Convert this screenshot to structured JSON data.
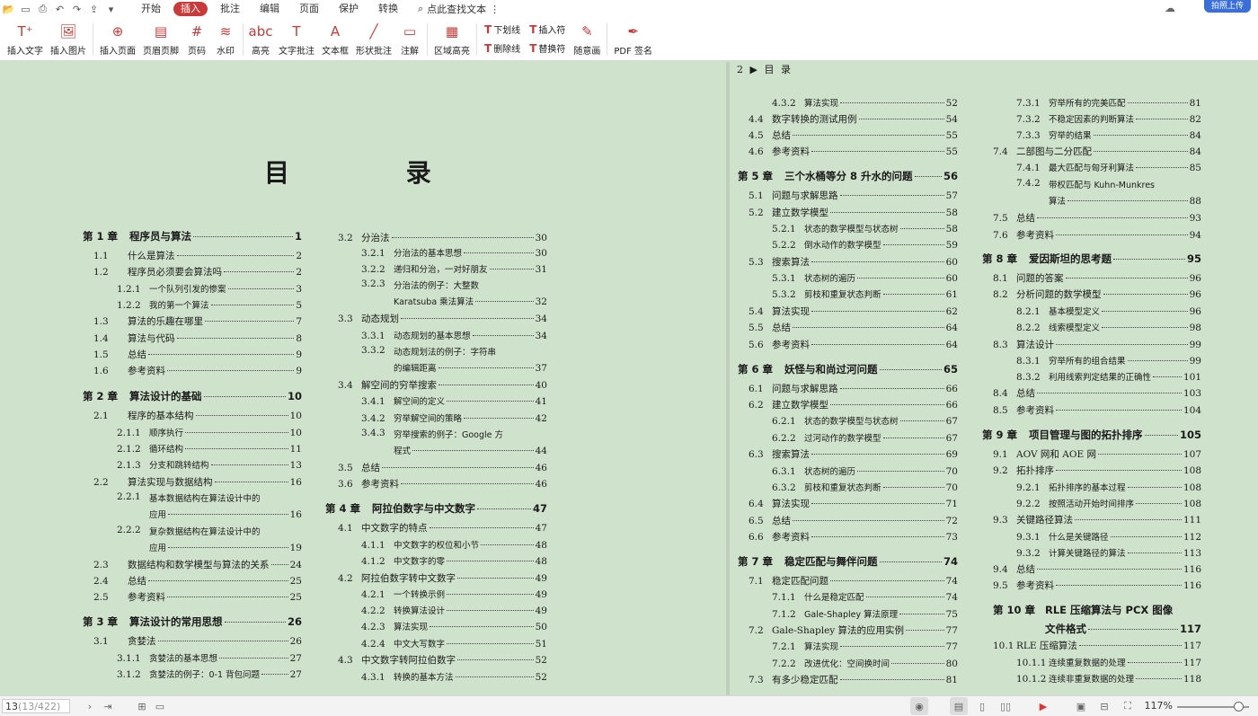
{
  "menu": {
    "tabs": [
      "开始",
      "插入",
      "批注",
      "编辑",
      "页面",
      "保护",
      "转换"
    ],
    "active_tab": "插入",
    "search": "点此查找文本",
    "upload": "拍照上传"
  },
  "ribbon": {
    "buttons": [
      {
        "name": "insert-text",
        "label": "插入文字",
        "icon": "text-insert-icon"
      },
      {
        "name": "insert-image",
        "label": "插入图片",
        "icon": "image-icon"
      },
      {
        "name": "insert-page",
        "label": "插入页面",
        "icon": "page-add-icon"
      },
      {
        "name": "header-footer",
        "label": "页眉页脚",
        "icon": "header-footer-icon"
      },
      {
        "name": "page-number",
        "label": "页码",
        "icon": "page-number-icon"
      },
      {
        "name": "watermark",
        "label": "水印",
        "icon": "watermark-icon"
      },
      {
        "name": "highlight",
        "label": "高亮",
        "icon": "highlight-icon"
      },
      {
        "name": "text-comment",
        "label": "文字批注",
        "icon": "text-comment-icon"
      },
      {
        "name": "textbox",
        "label": "文本框",
        "icon": "textbox-icon"
      },
      {
        "name": "shape-comment",
        "label": "形状批注",
        "icon": "shape-icon"
      },
      {
        "name": "annotation",
        "label": "注解",
        "icon": "annotation-icon"
      },
      {
        "name": "area-highlight",
        "label": "区域高亮",
        "icon": "area-highlight-icon"
      }
    ],
    "small": [
      [
        "下划线",
        "删除线"
      ],
      [
        "插入符",
        "替换符"
      ]
    ],
    "freehand": "随意画",
    "pdfsign": "PDF 签名"
  },
  "page": {
    "title": "目 录",
    "right_header": "2 ▶ 目 录"
  },
  "toc": {
    "col1": [
      {
        "t": "c",
        "n": "第 1 章",
        "x": "程序员与算法",
        "p": "1"
      },
      {
        "t": "s",
        "n": "1.1",
        "x": "什么是算法",
        "p": "2"
      },
      {
        "t": "s",
        "n": "1.2",
        "x": "程序员必须要会算法吗",
        "p": "2"
      },
      {
        "t": "d",
        "n": "1.2.1",
        "x": "一个队列引发的惨案",
        "p": "3"
      },
      {
        "t": "d",
        "n": "1.2.2",
        "x": "我的第一个算法",
        "p": "5"
      },
      {
        "t": "s",
        "n": "1.3",
        "x": "算法的乐趣在哪里",
        "p": "7"
      },
      {
        "t": "s",
        "n": "1.4",
        "x": "算法与代码",
        "p": "8"
      },
      {
        "t": "s",
        "n": "1.5",
        "x": "总结",
        "p": "9"
      },
      {
        "t": "s",
        "n": "1.6",
        "x": "参考资料",
        "p": "9"
      },
      {
        "t": "c",
        "n": "第 2 章",
        "x": "算法设计的基础",
        "p": "10"
      },
      {
        "t": "s",
        "n": "2.1",
        "x": "程序的基本结构",
        "p": "10"
      },
      {
        "t": "d",
        "n": "2.1.1",
        "x": "顺序执行",
        "p": "10"
      },
      {
        "t": "d",
        "n": "2.1.2",
        "x": "循环结构",
        "p": "11"
      },
      {
        "t": "d",
        "n": "2.1.3",
        "x": "分支和跳转结构",
        "p": "13"
      },
      {
        "t": "s",
        "n": "2.2",
        "x": "算法实现与数据结构",
        "p": "16"
      },
      {
        "t": "w",
        "n": "2.2.1",
        "x": "基本数据结构在算法设计中的",
        "x2": "应用",
        "p": "16"
      },
      {
        "t": "w",
        "n": "2.2.2",
        "x": "复杂数据结构在算法设计中的",
        "x2": "应用",
        "p": "19"
      },
      {
        "t": "s",
        "n": "2.3",
        "x": "数据结构和数学模型与算法的关系",
        "p": "24"
      },
      {
        "t": "s",
        "n": "2.4",
        "x": "总结",
        "p": "25"
      },
      {
        "t": "s",
        "n": "2.5",
        "x": "参考资料",
        "p": "25"
      },
      {
        "t": "c",
        "n": "第 3 章",
        "x": "算法设计的常用思想",
        "p": "26"
      },
      {
        "t": "s",
        "n": "3.1",
        "x": "贪婪法",
        "p": "26"
      },
      {
        "t": "d",
        "n": "3.1.1",
        "x": "贪婪法的基本思想",
        "p": "27"
      },
      {
        "t": "d",
        "n": "3.1.2",
        "x": "贪婪法的例子：0-1 背包问题",
        "p": "27"
      }
    ],
    "col2": [
      {
        "t": "s",
        "n": "3.2",
        "x": "分治法",
        "p": "30"
      },
      {
        "t": "d",
        "n": "3.2.1",
        "x": "分治法的基本思想",
        "p": "30"
      },
      {
        "t": "d",
        "n": "3.2.2",
        "x": "递归和分治，一对好朋友",
        "p": "31"
      },
      {
        "t": "w",
        "n": "3.2.3",
        "x": "分治法的例子：大整数",
        "x2": "Karatsuba 乘法算法",
        "p": "32"
      },
      {
        "t": "s",
        "n": "3.3",
        "x": "动态规划",
        "p": "34"
      },
      {
        "t": "d",
        "n": "3.3.1",
        "x": "动态规划的基本思想",
        "p": "34"
      },
      {
        "t": "w",
        "n": "3.3.2",
        "x": "动态规划法的例子：字符串",
        "x2": "的编辑距离",
        "p": "37"
      },
      {
        "t": "s",
        "n": "3.4",
        "x": "解空间的穷举搜索",
        "p": "40"
      },
      {
        "t": "d",
        "n": "3.4.1",
        "x": "解空间的定义",
        "p": "41"
      },
      {
        "t": "d",
        "n": "3.4.2",
        "x": "穷举解空间的策略",
        "p": "42"
      },
      {
        "t": "w",
        "n": "3.4.3",
        "x": "穷举搜索的例子：Google 方",
        "x2": "程式",
        "p": "44"
      },
      {
        "t": "s",
        "n": "3.5",
        "x": "总结",
        "p": "46"
      },
      {
        "t": "s",
        "n": "3.6",
        "x": "参考资料",
        "p": "46"
      },
      {
        "t": "c",
        "n": "第 4 章",
        "x": "阿拉伯数字与中文数字",
        "p": "47"
      },
      {
        "t": "s",
        "n": "4.1",
        "x": "中文数字的特点",
        "p": "47"
      },
      {
        "t": "d",
        "n": "4.1.1",
        "x": "中文数字的权位和小节",
        "p": "48"
      },
      {
        "t": "d",
        "n": "4.1.2",
        "x": "中文数字的零",
        "p": "48"
      },
      {
        "t": "s",
        "n": "4.2",
        "x": "阿拉伯数字转中文数字",
        "p": "49"
      },
      {
        "t": "d",
        "n": "4.2.1",
        "x": "一个转换示例",
        "p": "49"
      },
      {
        "t": "d",
        "n": "4.2.2",
        "x": "转换算法设计",
        "p": "49"
      },
      {
        "t": "d",
        "n": "4.2.3",
        "x": "算法实现",
        "p": "50"
      },
      {
        "t": "d",
        "n": "4.2.4",
        "x": "中文大写数字",
        "p": "51"
      },
      {
        "t": "s",
        "n": "4.3",
        "x": "中文数字转阿拉伯数字",
        "p": "52"
      },
      {
        "t": "d",
        "n": "4.3.1",
        "x": "转换的基本方法",
        "p": "52"
      }
    ],
    "col3": [
      {
        "t": "d",
        "n": "4.3.2",
        "x": "算法实现",
        "p": "52"
      },
      {
        "t": "s",
        "n": "4.4",
        "x": "数字转换的测试用例",
        "p": "54"
      },
      {
        "t": "s",
        "n": "4.5",
        "x": "总结",
        "p": "55"
      },
      {
        "t": "s",
        "n": "4.6",
        "x": "参考资料",
        "p": "55"
      },
      {
        "t": "c",
        "n": "第 5 章",
        "x": "三个水桶等分 8 升水的问题",
        "p": "56"
      },
      {
        "t": "s",
        "n": "5.1",
        "x": "问题与求解思路",
        "p": "57"
      },
      {
        "t": "s",
        "n": "5.2",
        "x": "建立数学模型",
        "p": "58"
      },
      {
        "t": "d",
        "n": "5.2.1",
        "x": "状态的数学模型与状态树",
        "p": "58"
      },
      {
        "t": "d",
        "n": "5.2.2",
        "x": "倒水动作的数学模型",
        "p": "59"
      },
      {
        "t": "s",
        "n": "5.3",
        "x": "搜索算法",
        "p": "60"
      },
      {
        "t": "d",
        "n": "5.3.1",
        "x": "状态树的遍历",
        "p": "60"
      },
      {
        "t": "d",
        "n": "5.3.2",
        "x": "剪枝和重复状态判断",
        "p": "61"
      },
      {
        "t": "s",
        "n": "5.4",
        "x": "算法实现",
        "p": "62"
      },
      {
        "t": "s",
        "n": "5.5",
        "x": "总结",
        "p": "64"
      },
      {
        "t": "s",
        "n": "5.6",
        "x": "参考资料",
        "p": "64"
      },
      {
        "t": "c",
        "n": "第 6 章",
        "x": "妖怪与和尚过河问题",
        "p": "65"
      },
      {
        "t": "s",
        "n": "6.1",
        "x": "问题与求解思路",
        "p": "66"
      },
      {
        "t": "s",
        "n": "6.2",
        "x": "建立数学模型",
        "p": "66"
      },
      {
        "t": "d",
        "n": "6.2.1",
        "x": "状态的数学模型与状态树",
        "p": "67"
      },
      {
        "t": "d",
        "n": "6.2.2",
        "x": "过河动作的数学模型",
        "p": "67"
      },
      {
        "t": "s",
        "n": "6.3",
        "x": "搜索算法",
        "p": "69"
      },
      {
        "t": "d",
        "n": "6.3.1",
        "x": "状态树的遍历",
        "p": "70"
      },
      {
        "t": "d",
        "n": "6.3.2",
        "x": "剪枝和重复状态判断",
        "p": "70"
      },
      {
        "t": "s",
        "n": "6.4",
        "x": "算法实现",
        "p": "71"
      },
      {
        "t": "s",
        "n": "6.5",
        "x": "总结",
        "p": "72"
      },
      {
        "t": "s",
        "n": "6.6",
        "x": "参考资料",
        "p": "73"
      },
      {
        "t": "c",
        "n": "第 7 章",
        "x": "稳定匹配与舞伴问题",
        "p": "74"
      },
      {
        "t": "s",
        "n": "7.1",
        "x": "稳定匹配问题",
        "p": "74"
      },
      {
        "t": "d",
        "n": "7.1.1",
        "x": "什么是稳定匹配",
        "p": "74"
      },
      {
        "t": "d",
        "n": "7.1.2",
        "x": "Gale-Shapley 算法原理",
        "p": "75"
      },
      {
        "t": "s",
        "n": "7.2",
        "x": "Gale-Shapley 算法的应用实例",
        "p": "77"
      },
      {
        "t": "d",
        "n": "7.2.1",
        "x": "算法实现",
        "p": "77"
      },
      {
        "t": "d",
        "n": "7.2.2",
        "x": "改进优化：空间换时间",
        "p": "80"
      },
      {
        "t": "s",
        "n": "7.3",
        "x": "有多少稳定匹配",
        "p": "81"
      }
    ],
    "col4": [
      {
        "t": "d",
        "n": "7.3.1",
        "x": "穷举所有的完美匹配",
        "p": "81"
      },
      {
        "t": "d",
        "n": "7.3.2",
        "x": "不稳定因素的判断算法",
        "p": "82"
      },
      {
        "t": "d",
        "n": "7.3.3",
        "x": "穷举的结果",
        "p": "84"
      },
      {
        "t": "s",
        "n": "7.4",
        "x": "二部图与二分匹配",
        "p": "84"
      },
      {
        "t": "d",
        "n": "7.4.1",
        "x": "最大匹配与匈牙利算法",
        "p": "85"
      },
      {
        "t": "w",
        "n": "7.4.2",
        "x": "带权匹配与 Kuhn-Munkres",
        "x2": "算法",
        "p": "88"
      },
      {
        "t": "s",
        "n": "7.5",
        "x": "总结",
        "p": "93"
      },
      {
        "t": "s",
        "n": "7.6",
        "x": "参考资料",
        "p": "94"
      },
      {
        "t": "c",
        "n": "第 8 章",
        "x": "爱因斯坦的思考题",
        "p": "95"
      },
      {
        "t": "s",
        "n": "8.1",
        "x": "问题的答案",
        "p": "96"
      },
      {
        "t": "s",
        "n": "8.2",
        "x": "分析问题的数学模型",
        "p": "96"
      },
      {
        "t": "d",
        "n": "8.2.1",
        "x": "基本模型定义",
        "p": "96"
      },
      {
        "t": "d",
        "n": "8.2.2",
        "x": "线索模型定义",
        "p": "98"
      },
      {
        "t": "s",
        "n": "8.3",
        "x": "算法设计",
        "p": "99"
      },
      {
        "t": "d",
        "n": "8.3.1",
        "x": "穷举所有的组合结果",
        "p": "99"
      },
      {
        "t": "d",
        "n": "8.3.2",
        "x": "利用线索判定结果的正确性",
        "p": "101"
      },
      {
        "t": "s",
        "n": "8.4",
        "x": "总结",
        "p": "103"
      },
      {
        "t": "s",
        "n": "8.5",
        "x": "参考资料",
        "p": "104"
      },
      {
        "t": "c",
        "n": "第 9 章",
        "x": "项目管理与图的拓扑排序",
        "p": "105"
      },
      {
        "t": "s",
        "n": "9.1",
        "x": "AOV 网和 AOE 网",
        "p": "107"
      },
      {
        "t": "s",
        "n": "9.2",
        "x": "拓扑排序",
        "p": "108"
      },
      {
        "t": "d",
        "n": "9.2.1",
        "x": "拓扑排序的基本过程",
        "p": "108"
      },
      {
        "t": "d",
        "n": "9.2.2",
        "x": "按照活动开始时间排序",
        "p": "108"
      },
      {
        "t": "s",
        "n": "9.3",
        "x": "关键路径算法",
        "p": "111"
      },
      {
        "t": "d",
        "n": "9.3.1",
        "x": "什么是关键路径",
        "p": "112"
      },
      {
        "t": "d",
        "n": "9.3.2",
        "x": "计算关键路径的算法",
        "p": "113"
      },
      {
        "t": "s",
        "n": "9.4",
        "x": "总结",
        "p": "116"
      },
      {
        "t": "s",
        "n": "9.5",
        "x": "参考资料",
        "p": "116"
      },
      {
        "t": "cw",
        "n": "第 10 章",
        "x": "RLE 压缩算法与 PCX 图像",
        "x2": "文件格式",
        "p": "117"
      },
      {
        "t": "s",
        "n": "10.1",
        "x": "RLE 压缩算法",
        "p": "117"
      },
      {
        "t": "d",
        "n": "10.1.1",
        "x": "连续重复数据的处理",
        "p": "117"
      },
      {
        "t": "d",
        "n": "10.1.2",
        "x": "连续非重复数据的处理",
        "p": "118"
      }
    ]
  },
  "status": {
    "current_page": "13",
    "total": "(13/422)",
    "zoom": "117%"
  }
}
